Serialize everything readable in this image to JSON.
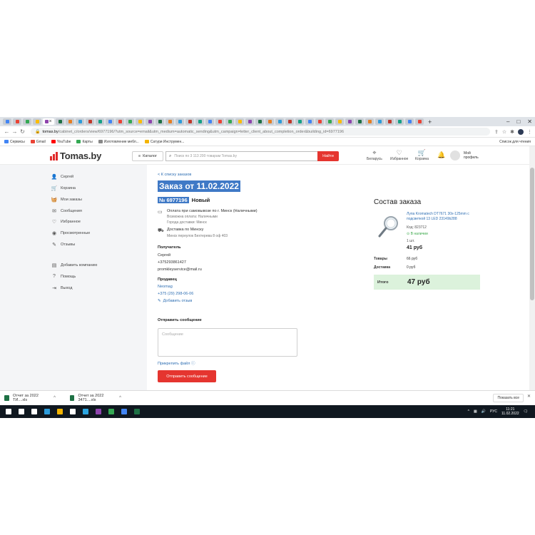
{
  "browser": {
    "tab_count_icons": 42,
    "url_host": "tomas.by",
    "url_path": "/cabinet_c/orders/view/6977196/?utm_source=email&utm_medium=automatic_sending&utm_campaign=letter_client_about_completion_order&building_id=6977196",
    "bookmarks": [
      {
        "label": "Сервисы",
        "color": "#4285f4"
      },
      {
        "label": "Gmail",
        "color": "#ea4335"
      },
      {
        "label": "YouTube",
        "color": "#ff0000"
      },
      {
        "label": "Карты",
        "color": "#34a853"
      },
      {
        "label": "Изготовление мебл...",
        "color": "#888888"
      },
      {
        "label": "Сатури Инструмен...",
        "color": "#f4b400"
      }
    ],
    "bookmarks_right": "Список для чтения"
  },
  "header": {
    "logo": "Tomas.by",
    "catalog": "Каталог",
    "search_placeholder": "Поиск по 3 113 200 товарам Tomas.by",
    "search_button": "Найти",
    "region": "Беларусь",
    "favorites": "Избранное",
    "cart": "Корзина",
    "profile": "Мой профиль"
  },
  "sidebar": {
    "items": [
      {
        "label": "Сергей",
        "icon": "user-icon"
      },
      {
        "label": "Корзина",
        "icon": "cart-icon"
      },
      {
        "label": "Мои заказы",
        "icon": "basket-icon"
      },
      {
        "label": "Сообщения",
        "icon": "mail-icon"
      },
      {
        "label": "Избранное",
        "icon": "heart-icon"
      },
      {
        "label": "Просмотренные",
        "icon": "eye-icon"
      },
      {
        "label": "Отзывы",
        "icon": "review-icon"
      },
      {
        "label": "Добавить компанию",
        "icon": "building-icon"
      },
      {
        "label": "Помощь",
        "icon": "help-icon"
      },
      {
        "label": "Выход",
        "icon": "logout-icon"
      }
    ]
  },
  "order": {
    "back": "< К списку заказов",
    "title": "Заказ от 11.02.2022",
    "number": "№ 6977196",
    "status": "Новый",
    "payment": "Оплата при самовывозе по г. Минск (Наличными)",
    "payment_sub1": "Возможна оплата: Наличными",
    "payment_sub2": "Города доставки: Минск",
    "delivery": "Доставка по Минску",
    "delivery_address": "Минск переулок Бехтерева 8 оф 403",
    "recipient_h": "Получатель",
    "recipient_name": "Сергей",
    "recipient_phone": "+375293861427",
    "recipient_email": "promkleyservice@mail.ru",
    "seller_h": "Продавец",
    "seller_name": "Neomag",
    "seller_phone": "+375 (29) 298-06-06",
    "add_review": "Добавить отзыв",
    "send_msg_h": "Отправить сообщение",
    "msg_placeholder": "Сообщение",
    "attach": "Прикрепить файл",
    "send_button": "Отправить сообщение"
  },
  "composition": {
    "title": "Состав заказа",
    "product_name": "Лупа Kromatech DT7671 30x-125mm с подсветкой 13 LED 23149b288",
    "code": "Код: 823712",
    "stock": "В наличии",
    "qty": "1 шт.",
    "price": "41 руб",
    "goods_label": "Товары",
    "goods_value": "66 руб",
    "delivery_label": "Доставка",
    "delivery_value": "0 руб",
    "total_label": "Итого",
    "total_value": "47 руб"
  },
  "downloads": {
    "items": [
      "Отчет за 2022 ТИ....xls",
      "Отчет за 2022 3471....xls"
    ],
    "show_all": "Показать все"
  },
  "taskbar": {
    "lang": "РУС",
    "time": "11:21",
    "date": "11.02.2022"
  }
}
